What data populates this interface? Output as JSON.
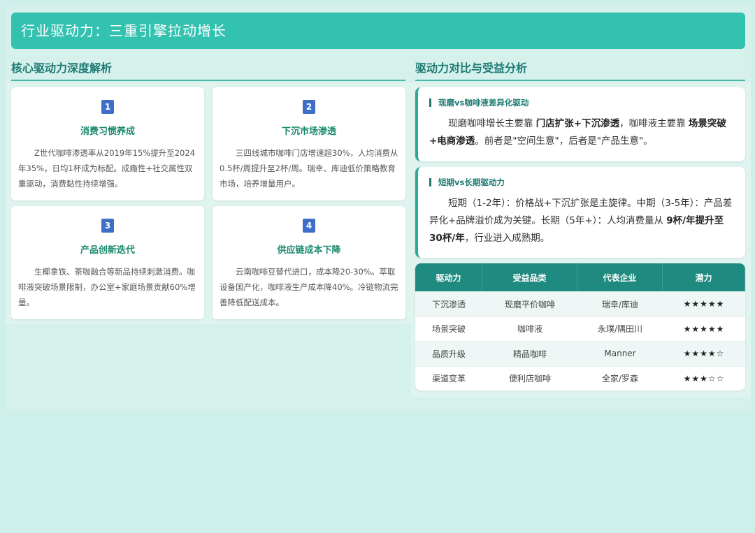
{
  "header": {
    "title": "行业驱动力：三重引擎拉动增长"
  },
  "left_section": {
    "title": "核心驱动力深度解析",
    "cards": [
      {
        "num": "1",
        "title": "消费习惯养成",
        "text": "Z世代咖啡渗透率从2019年15%提升至2024年35%，日均1杯成为标配。成瘾性+社交属性双重驱动，消费黏性持续增强。"
      },
      {
        "num": "2",
        "title": "下沉市场渗透",
        "text": "三四线城市咖啡门店增速超30%，人均消费从0.5杯/周提升至2杯/周。瑞幸、库迪低价策略教育市场，培养增量用户。"
      },
      {
        "num": "3",
        "title": "产品创新迭代",
        "text": "生椰拿铁、茶咖融合等新品持续刺激消费。咖啡液突破场景限制，办公室+家庭场景贡献60%增量。"
      },
      {
        "num": "4",
        "title": "供应链成本下降",
        "text": "云南咖啡豆替代进口，成本降20-30%。萃取设备国产化，咖啡液生产成本降40%。冷链物流完善降低配送成本。"
      }
    ]
  },
  "right_section": {
    "title": "驱动力对比与受益分析",
    "box1": {
      "title": "现磨vs咖啡液差异化驱动",
      "t1": "现磨咖啡增长主要靠 ",
      "b1": "门店扩张+下沉渗透",
      "t2": "，咖啡液主要靠 ",
      "b2": "场景突破+电商渗透",
      "t3": "。前者是\"空间生意\"，后者是\"产品生意\"。"
    },
    "box2": {
      "title": "短期vs长期驱动力",
      "t1": "短期（1-2年）：价格战+下沉扩张是主旋律。中期（3-5年）：产品差异化+品牌溢价成为关键。长期（5年+）：人均消费量从 ",
      "b1": "9杯/年提升至30杯/年",
      "t2": "，行业进入成熟期。"
    },
    "table": {
      "headers": [
        "驱动力",
        "受益品类",
        "代表企业",
        "潜力"
      ],
      "rows": [
        [
          "下沉渗透",
          "现磨平价咖啡",
          "瑞幸/库迪",
          "★★★★★"
        ],
        [
          "场景突破",
          "咖啡液",
          "永璞/隅田川",
          "★★★★★"
        ],
        [
          "品质升级",
          "精品咖啡",
          "Manner",
          "★★★★☆"
        ],
        [
          "渠道变革",
          "便利店咖啡",
          "全家/罗森",
          "★★★☆☆"
        ]
      ]
    }
  }
}
